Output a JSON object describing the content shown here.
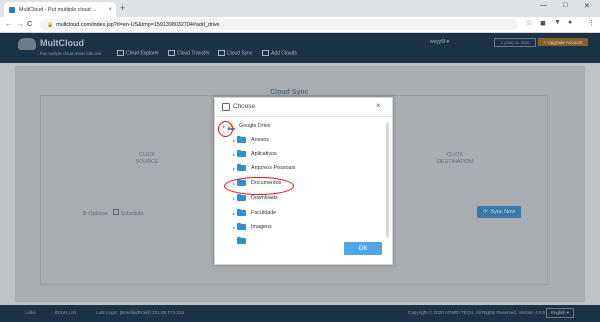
{
  "browser": {
    "tab_title": "MultCloud - Put multiple cloud ...",
    "url": "multcloud.com/index.jsp?rl=en-US&tmp=1591398032704#add_drive",
    "new_tab": "+",
    "tab_close": "×",
    "back": "←",
    "forward": "→",
    "reload": "C",
    "minimize": "—",
    "maximize": "□",
    "close": "✕",
    "lock": "🔒"
  },
  "header": {
    "brand": "MultCloud",
    "tagline": "Put multiple cloud drives into one",
    "nav": [
      "Cloud Explorer",
      "Cloud Transfer",
      "Cloud Sync",
      "Add Clouds"
    ],
    "user": "wvyy5f ▾",
    "phone": "1 (866) 31-3500",
    "upgrade": "+ Upgrade Account"
  },
  "main": {
    "title": "Cloud Sync",
    "source_line1": "CLICK",
    "source_line2": "SOURCE",
    "dest_line1": "CLICK",
    "dest_line2": "DESTINATION",
    "options": "Options",
    "schedule": "Schedule",
    "sync_button": "Sync Now"
  },
  "footer": {
    "links": "Links",
    "errors": "Errors List",
    "last_login": "Last Login: (Brasília/Brasil) 201.88.174.224",
    "copyright": "Copyright © 2020 AOMEI TECH. All Rights Reserved. Version 4.5.5",
    "language": "English ▾"
  },
  "dialog": {
    "title": "Choose",
    "close": "×",
    "root": "Google Drive",
    "expander": "▸",
    "folders": [
      "Anexos",
      "Aplicativos",
      "Arquivos Pessoais",
      "Documentos",
      "Downloads",
      "Faculdade",
      "Imagens"
    ],
    "ok_button": "OK"
  },
  "colors": {
    "accent": "#4fa8e3",
    "highlight_ring": "#e0141c",
    "folder": "#2f8fd0"
  }
}
